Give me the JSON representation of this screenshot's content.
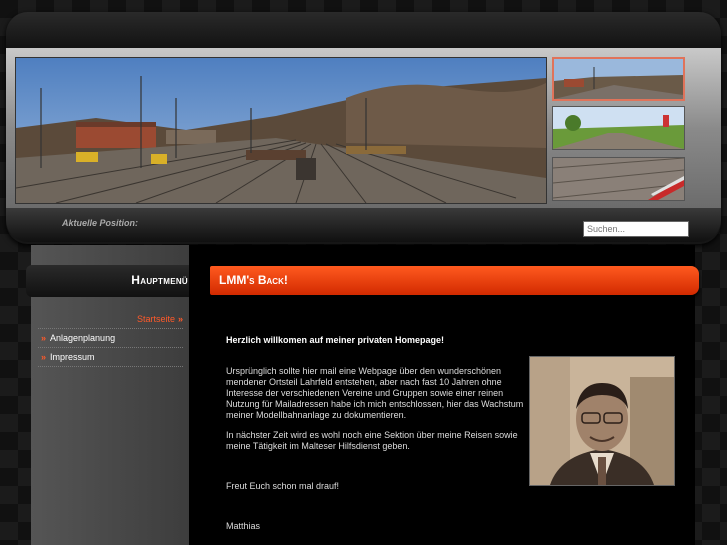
{
  "header": {
    "position_label": "Aktuelle Position:",
    "search_placeholder": "Suchen..."
  },
  "sidebar": {
    "title": "Hauptmenü",
    "items": [
      {
        "label": "Startseite",
        "active": true
      },
      {
        "label": "Anlagenplanung",
        "active": false
      },
      {
        "label": "Impressum",
        "active": false
      }
    ]
  },
  "article": {
    "title": "LMM's Back!",
    "welcome": "Herzlich willkomen auf meiner privaten Homepage!",
    "para1": "Ursprünglich sollte hier mail eine Webpage über den wunderschönen mendener Ortsteil Lahrfeld entstehen, aber nach fast 10 Jahren ohne Interesse der verschiedenen Vereine und Gruppen sowie einer reinen Nutzung für Mailadressen habe ich mich entschlossen, hier das Wachstum meiner Modellbahnanlage zu dokumentieren.",
    "para2": "In nächster Zeit wird es wohl noch eine Sektion über meine Reisen sowie meine Tätigkeit im Malteser Hilfsdienst geben.",
    "para3": "Freut Euch schon mal drauf!",
    "signature": "Matthias"
  },
  "colors": {
    "accent": "#ff5a1f",
    "accent_dark": "#d22a00",
    "menu_icon": "#ff5a2a"
  },
  "icons": {
    "menu_bullet": "»"
  }
}
